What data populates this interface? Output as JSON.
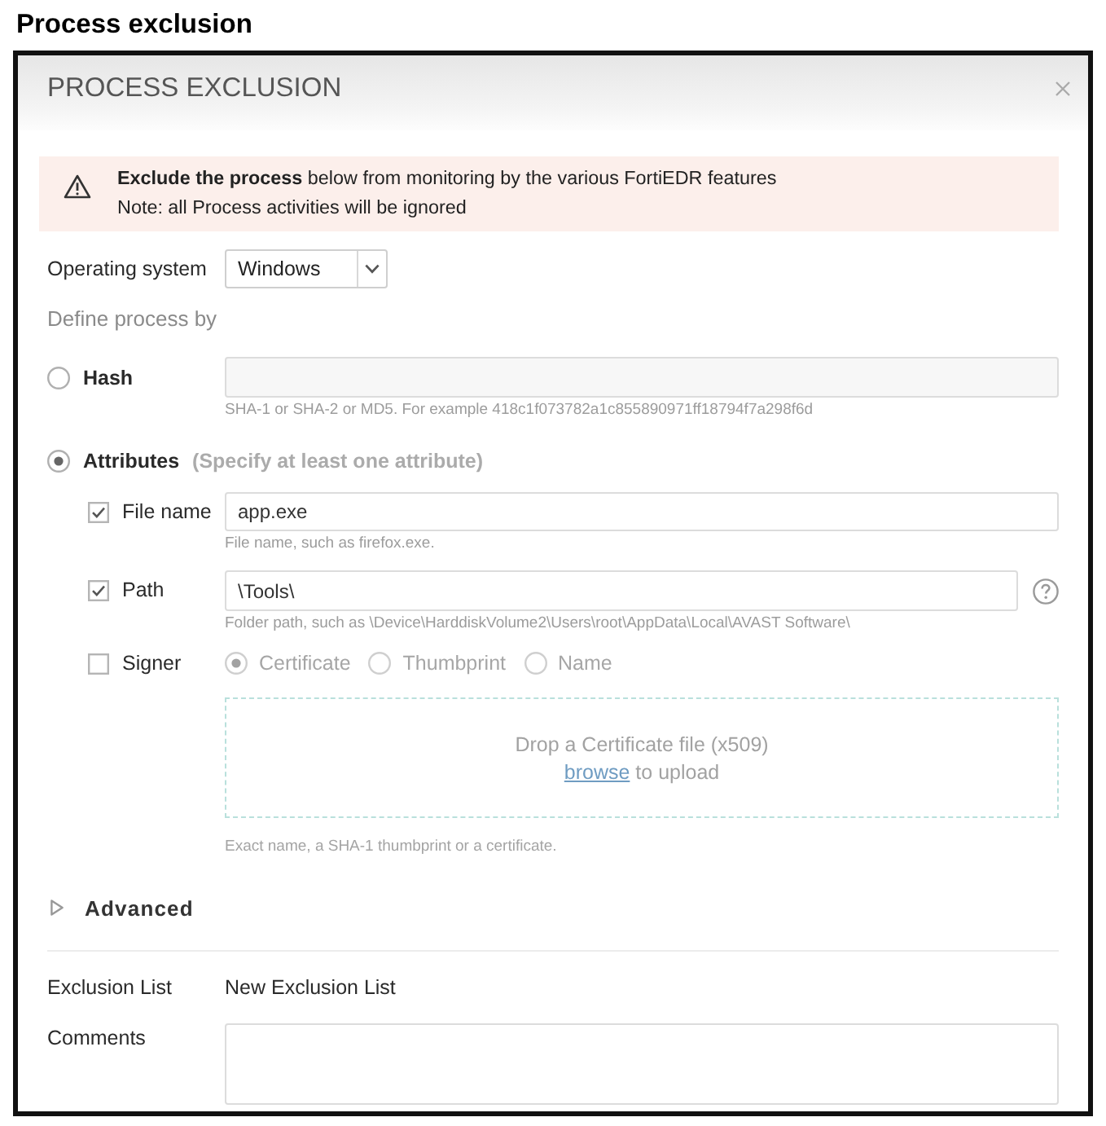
{
  "caption": "Process exclusion",
  "dialog": {
    "title": "PROCESS EXCLUSION"
  },
  "notice": {
    "text": "**Exclude the process** below from monitoring by the various FortiEDR features",
    "note": "Note: all Process activities will be ignored"
  },
  "operating_system": {
    "label": "Operating system",
    "value": "Windows"
  },
  "define_label": "Define process by",
  "hash": {
    "label": "Hash",
    "selected": false,
    "hint": "SHA-1 or SHA-2 or MD5. For example 418c1f073782a1c855890971ff18794f7a298f6d"
  },
  "attributes": {
    "label": "Attributes",
    "selected": true,
    "note": "(Specify at least one attribute)",
    "items": [
      {
        "kind": "text",
        "label": "File name",
        "checked": true,
        "value": "app.exe",
        "hint": "File name, such as firefox.exe."
      },
      {
        "kind": "text",
        "label": "Path",
        "checked": true,
        "value": "\\Tools\\",
        "hint": "Folder path, such as \\Device\\HarddiskVolume2\\Users\\root\\AppData\\Local\\AVAST Software\\",
        "help": true
      },
      {
        "kind": "signer",
        "label": "Signer",
        "checked": false,
        "options": [
          {
            "label": "Certificate",
            "selected": true
          },
          {
            "label": "Thumbprint",
            "selected": false
          },
          {
            "label": "Name",
            "selected": false
          }
        ],
        "dropzone": {
          "title": "Drop a Certificate file (x509)",
          "link": "browse",
          "text": "to upload"
        },
        "hint": "Exact name, a SHA-1 thumbprint or a certificate."
      }
    ]
  },
  "advanced": {
    "label": "Advanced",
    "expanded": false
  },
  "exclusion_list": {
    "label": "Exclusion List",
    "value": "New Exclusion List"
  },
  "comments": {
    "label": "Comments"
  }
}
